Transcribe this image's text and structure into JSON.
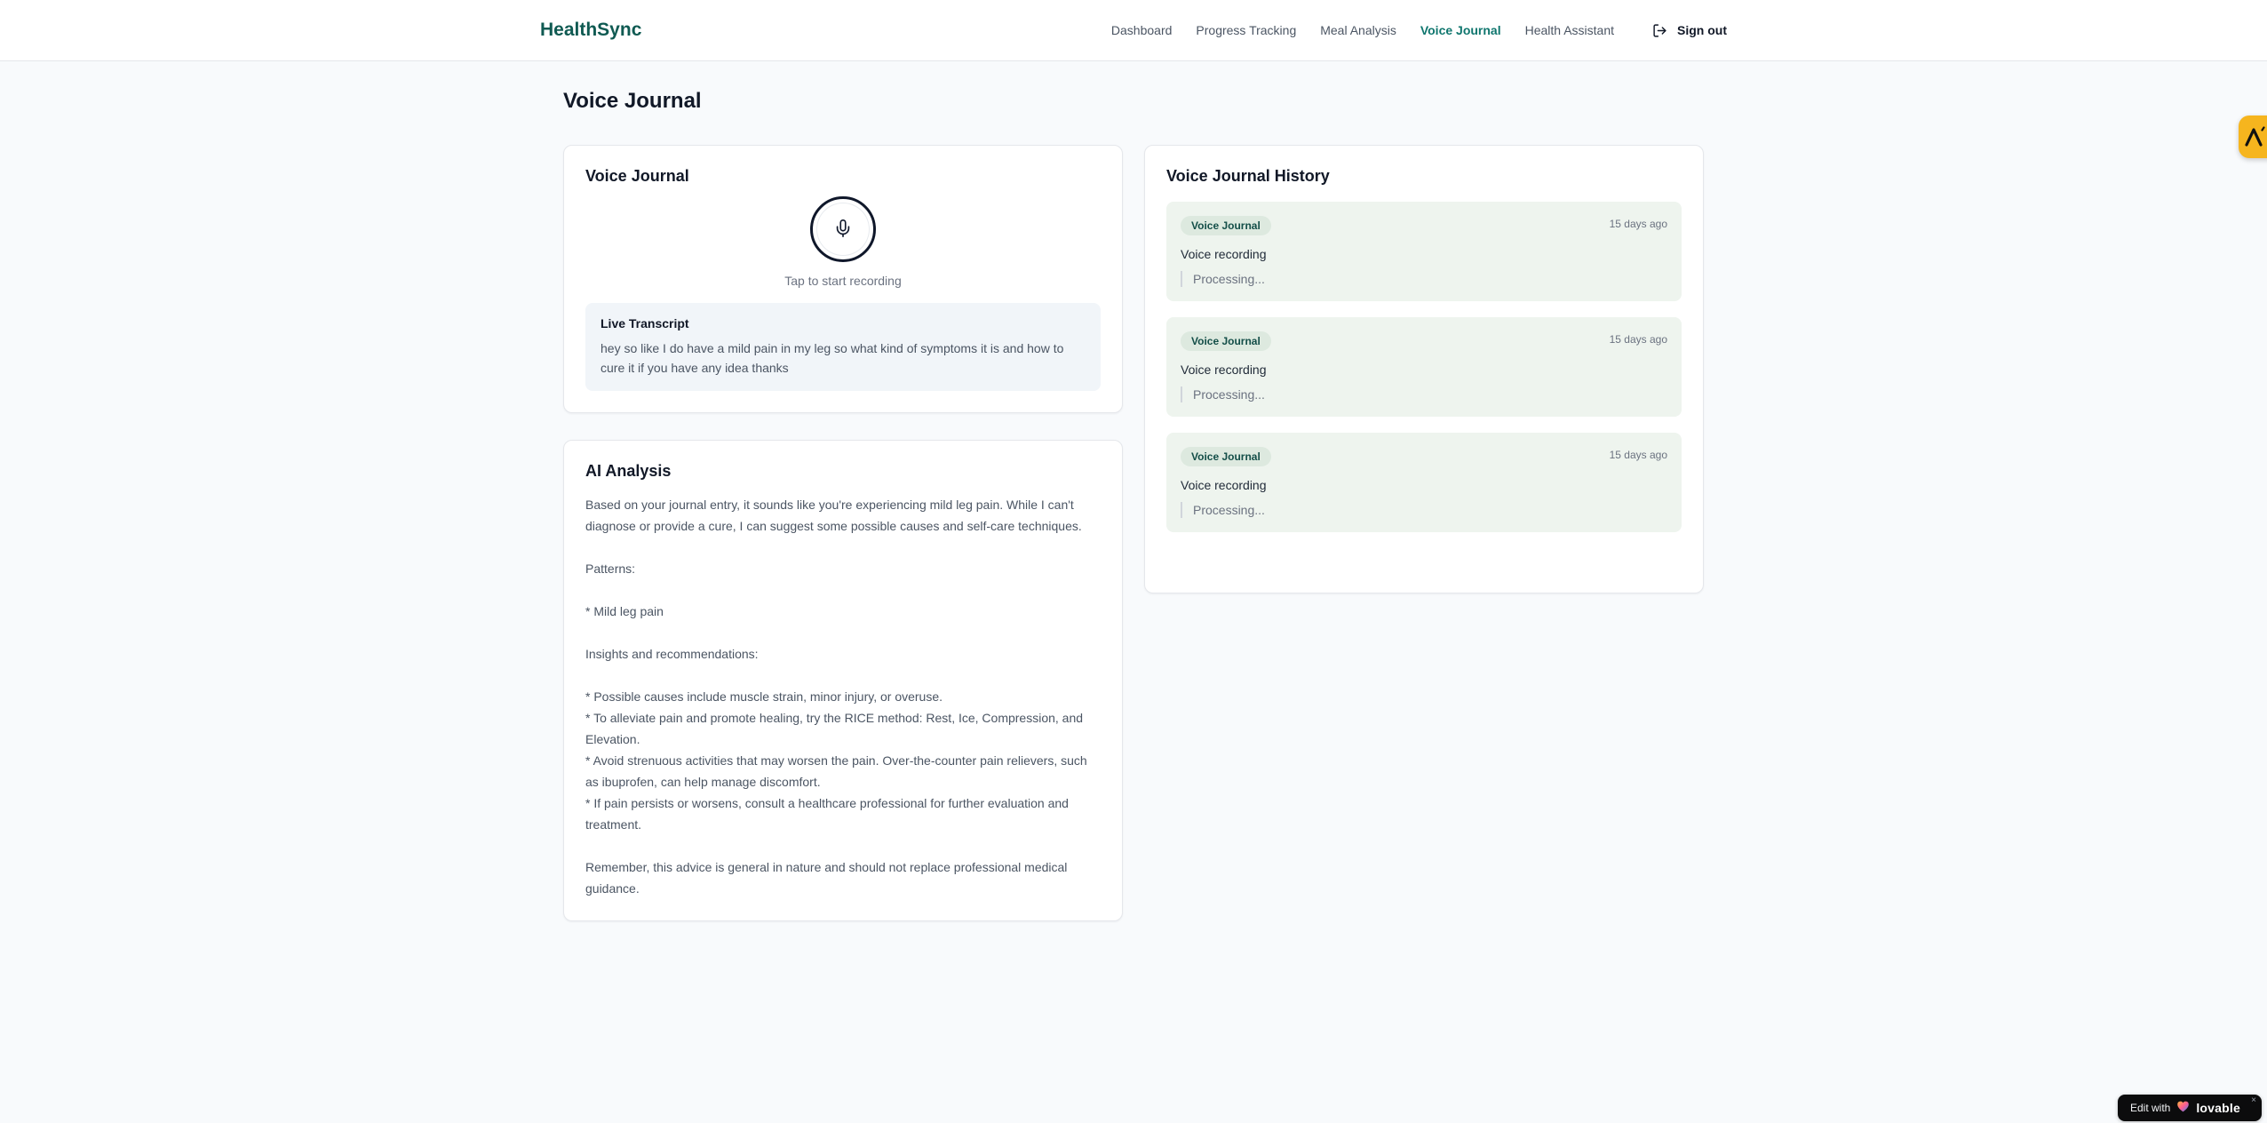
{
  "header": {
    "brand": "HealthSync",
    "nav_items": [
      {
        "label": "Dashboard"
      },
      {
        "label": "Progress Tracking"
      },
      {
        "label": "Meal Analysis"
      },
      {
        "label": "Voice Journal"
      },
      {
        "label": "Health Assistant"
      }
    ],
    "sign_out_label": "Sign out"
  },
  "page": {
    "title": "Voice Journal"
  },
  "recorder_card": {
    "title": "Voice Journal",
    "tap_hint": "Tap to start recording",
    "transcript_title": "Live Transcript",
    "transcript_text": "hey so like I do have a mild pain in my leg so what kind of symptoms it is and how to cure it if you have any idea thanks"
  },
  "analysis_card": {
    "title": "AI Analysis",
    "body": "Based on your journal entry, it sounds like you're experiencing mild leg pain. While I can't diagnose or provide a cure, I can suggest some possible causes and self-care techniques.\n\nPatterns:\n\n* Mild leg pain\n\nInsights and recommendations:\n\n* Possible causes include muscle strain, minor injury, or overuse.\n* To alleviate pain and promote healing, try the RICE method: Rest, Ice, Compression, and Elevation.\n* Avoid strenuous activities that may worsen the pain. Over-the-counter pain relievers, such as ibuprofen, can help manage discomfort.\n* If pain persists or worsens, consult a healthcare professional for further evaluation and treatment.\n\nRemember, this advice is general in nature and should not replace professional medical guidance."
  },
  "history_card": {
    "title": "Voice Journal History",
    "entries": [
      {
        "badge": "Voice Journal",
        "time": "15 days ago",
        "label": "Voice recording",
        "status": "Processing..."
      },
      {
        "badge": "Voice Journal",
        "time": "15 days ago",
        "label": "Voice recording",
        "status": "Processing..."
      },
      {
        "badge": "Voice Journal",
        "time": "15 days ago",
        "label": "Voice recording",
        "status": "Processing..."
      }
    ]
  },
  "lovable_badge": {
    "edit_prefix": "Edit with",
    "brand": "lovable",
    "close_label": "×"
  },
  "colors": {
    "brand_teal": "#0f5a52",
    "nav_active_teal": "#0f766e",
    "accent_amber": "#f6b51e",
    "history_entry_bg": "#eef4ee",
    "badge_bg": "#dde9df",
    "badge_text": "#134e48",
    "lovable_bg": "#0c0c0d"
  }
}
